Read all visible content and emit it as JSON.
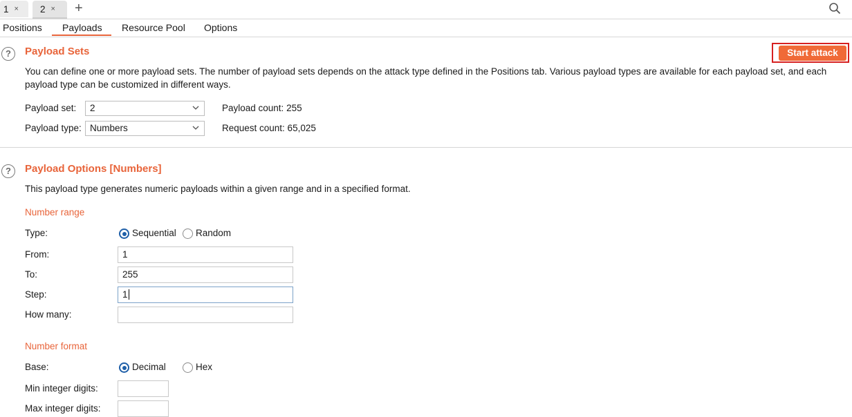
{
  "request_tabs": [
    {
      "label": "1",
      "close": "×"
    },
    {
      "label": "2",
      "close": "×"
    }
  ],
  "new_tab": "+",
  "subtabs": [
    "Positions",
    "Payloads",
    "Resource Pool",
    "Options"
  ],
  "payload_sets": {
    "title": "Payload Sets",
    "description_line1": "You can define one or more payload sets. The number of payload sets depends on the attack type defined in the Positions tab. Various payload types are available for each payload set, and each",
    "description_line2": "payload type can be customized in different ways.",
    "payload_set_label": "Payload set:",
    "payload_set_value": "2",
    "payload_type_label": "Payload type:",
    "payload_type_value": "Numbers",
    "payload_count": "Payload count: 255",
    "request_count": "Request count: 65,025",
    "start_attack": "Start attack"
  },
  "payload_options": {
    "title": "Payload Options [Numbers]",
    "description": "This payload type generates numeric payloads within a given range and in a specified format.",
    "number_range": {
      "heading": "Number range",
      "type_label": "Type:",
      "sequential": "Sequential",
      "random": "Random",
      "from_label": "From:",
      "from_value": "1",
      "to_label": "To:",
      "to_value": "255",
      "step_label": "Step:",
      "step_value": "1",
      "how_many_label": "How many:",
      "how_many_value": ""
    },
    "number_format": {
      "heading": "Number format",
      "base_label": "Base:",
      "decimal": "Decimal",
      "hex": "Hex",
      "min_int_label": "Min integer digits:",
      "min_int_value": "",
      "max_int_label": "Max integer digits:",
      "max_int_value": ""
    }
  },
  "colors": {
    "accent": "#e8643a",
    "button": "#f06a37",
    "highlight_box": "#d62020",
    "radio": "#1f5fa8"
  }
}
